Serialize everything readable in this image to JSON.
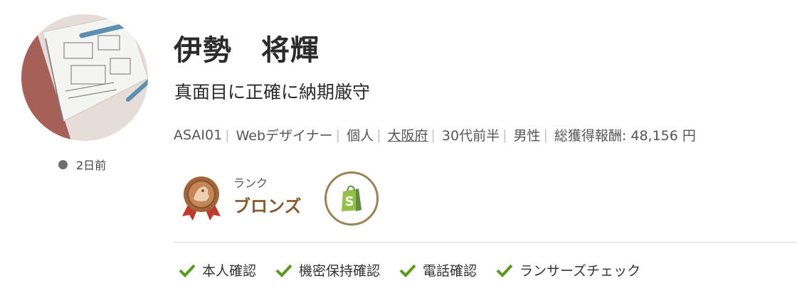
{
  "profile": {
    "name": "伊勢　将輝",
    "catchphrase": "真面目に正確に納期厳守",
    "last_login": "2日前",
    "avatar_icon": "avatar-photo-sketchbook"
  },
  "meta": {
    "username": "ASAI01",
    "occupation": "Webデザイナー",
    "type": "個人",
    "location": "大阪府",
    "age": "30代前半",
    "gender": "男性",
    "earnings": "総獲得報酬: 48,156 円"
  },
  "rank": {
    "label": "ランク",
    "value": "ブロンズ",
    "color": "#8a5a2e"
  },
  "badges": {
    "shopify_icon": "shopify-icon",
    "border_color": "#9c8256"
  },
  "verifications": [
    {
      "label": "本人確認"
    },
    {
      "label": "機密保持確認"
    },
    {
      "label": "電話確認"
    },
    {
      "label": "ランサーズチェック"
    }
  ],
  "colors": {
    "check": "#5a9a1a",
    "status_dot": "#6f6f6f"
  }
}
